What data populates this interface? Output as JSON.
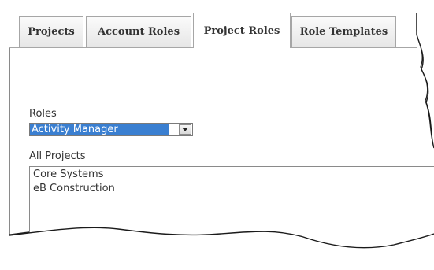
{
  "tabs": [
    {
      "label": "Projects",
      "active": false
    },
    {
      "label": "Account Roles",
      "active": false
    },
    {
      "label": "Project Roles",
      "active": true
    },
    {
      "label": "Role Templates",
      "active": false
    }
  ],
  "roles": {
    "label": "Roles",
    "selected": "Activity Manager"
  },
  "projects": {
    "label": "All Projects",
    "items": [
      "Core Systems",
      "eB Construction"
    ]
  },
  "colors": {
    "selection": "#3a7fd1",
    "border": "#8a8a8a",
    "text": "#333333"
  },
  "icons": {
    "dropdown": "chevron-down-icon"
  }
}
